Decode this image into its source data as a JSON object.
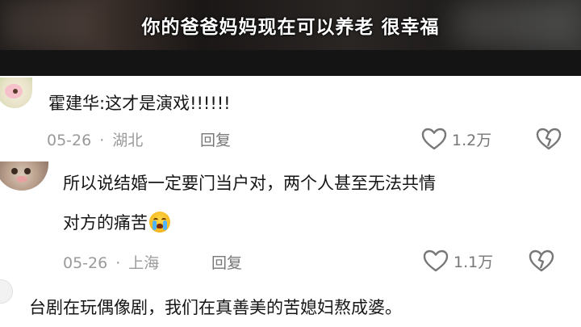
{
  "video": {
    "subtitle": "你的爸爸妈妈现在可以养老 很幸福"
  },
  "comments": [
    {
      "text": "霍建华:这才是演戏!!!!!!",
      "date": "05-26",
      "location": "湖北",
      "reply_label": "回复",
      "likes": "1.2万"
    },
    {
      "text_line1": "所以说结婚一定要门当户对，两个人甚至无法共情",
      "text_line2": "对方的痛苦",
      "emoji": "loudly-crying-face",
      "date": "05-26",
      "location": "上海",
      "reply_label": "回复",
      "likes": "1.1万"
    },
    {
      "text": "台剧在玩偶像剧，我们在真善美的苦媳妇熬成婆。"
    }
  ],
  "colors": {
    "meta": "#9a9a9a",
    "text": "#161616",
    "icon": "#777777"
  }
}
